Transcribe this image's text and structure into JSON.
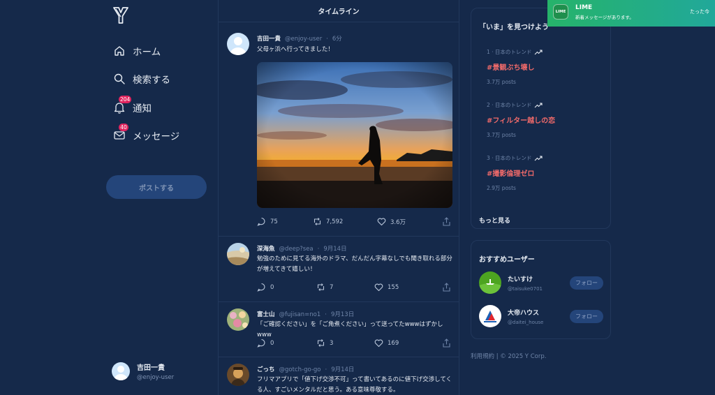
{
  "nav": {
    "items": [
      {
        "name": "home",
        "label": "ホーム"
      },
      {
        "name": "search",
        "label": "検索する"
      },
      {
        "name": "notifications",
        "label": "通知",
        "badge": "204"
      },
      {
        "name": "messages",
        "label": "メッセージ",
        "badge": "40"
      }
    ],
    "post_label": "ポストする",
    "user": {
      "name": "吉田一貴",
      "handle": "@enjoy-user"
    }
  },
  "timeline": {
    "title": "タイムライン",
    "posts": [
      {
        "name": "吉田一貴",
        "handle": "@enjoy-user",
        "time": "6分",
        "text": "父母ヶ浜へ行ってきました！",
        "replies": "75",
        "reposts": "7,592",
        "likes": "3.6万"
      },
      {
        "name": "深海魚",
        "handle": "@deep?sea",
        "time": "9月14日",
        "text": "勉強のために見てる海外のドラマ、だんだん字幕なしでも聞き取れる部分が増えてきて嬉しい！",
        "replies": "0",
        "reposts": "7",
        "likes": "155"
      },
      {
        "name": "富士山",
        "handle": "@fujisan=no1",
        "time": "9月13日",
        "text": "「ご確認ください」を「ご角煮ください」って送ってたwwwはずかしwww",
        "replies": "0",
        "reposts": "3",
        "likes": "169"
      },
      {
        "name": "ごっち",
        "handle": "@gotch-go-go",
        "time": "9月14日",
        "text": "フリマアプリで「値下げ交渉不可」って書いてあるのに値下げ交渉してくる人、すごいメンタルだと思う。ある意味尊敬する。"
      }
    ]
  },
  "trends": {
    "title": "「いま」を見つけよう",
    "items": [
      {
        "context": "1 · 日本のトレンド",
        "tag": "#景観ぶち壊し",
        "posts": "3.7万 posts"
      },
      {
        "context": "2 · 日本のトレンド",
        "tag": "#フィルター越しの恋",
        "posts": "3.7万 posts"
      },
      {
        "context": "3 · 日本のトレンド",
        "tag": "#撮影倫理ゼロ",
        "posts": "2.9万 posts"
      }
    ],
    "more_label": "もっと見る"
  },
  "recommend": {
    "title": "おすすめユーザー",
    "users": [
      {
        "name": "たいすけ",
        "handle": "@taisuke0701",
        "follow_label": "フォロー"
      },
      {
        "name": "大帝ハウス",
        "handle": "@daitei_house",
        "follow_label": "フォロー"
      }
    ]
  },
  "footer": {
    "text": "利用規約 | © 2025 Y Corp."
  },
  "notification": {
    "app_icon": "LIME",
    "app": "LIME",
    "message": "新着メッセージがあります。",
    "time": "たった今"
  },
  "colors": {
    "background": "#15294a",
    "accent": "#24457a",
    "trend": "#f06a6a",
    "notification": "#26b36a"
  }
}
